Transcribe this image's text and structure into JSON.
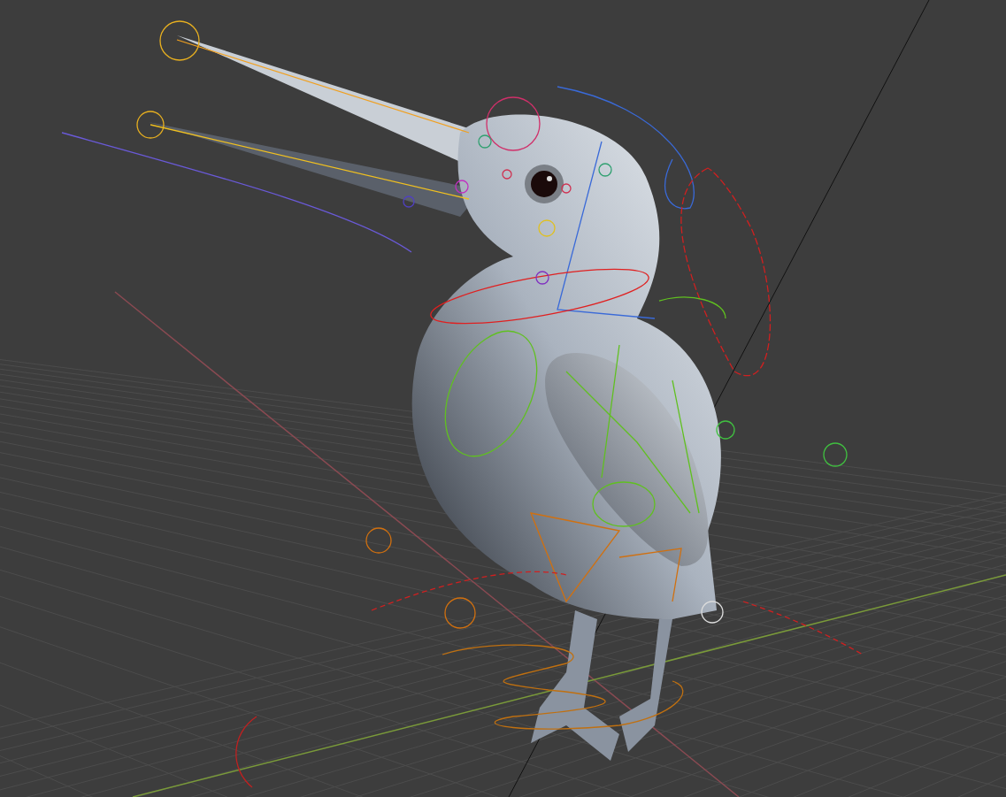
{
  "viewport": {
    "show_grid": true,
    "show_rig": true
  }
}
